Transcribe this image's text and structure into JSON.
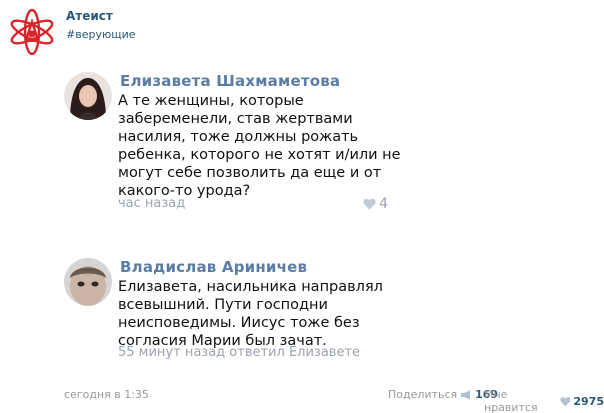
{
  "group": {
    "name": "Атеист",
    "hashtag": "#верующие"
  },
  "comments": [
    {
      "author": "Елизавета Шахмаметова",
      "lines": [
        "А те женщины, которые",
        "забеременели, став жертвами",
        "насилия, тоже должны рожать",
        "ребенка, которого не хотят и/или не",
        "могут себе позволить да еще и от",
        "какого-то урода?"
      ],
      "meta": "час назад",
      "likes": "4"
    },
    {
      "author": "Владислав Ариничев",
      "lines": [
        "Елизавета, насильника направлял",
        "всевышний. Пути господни",
        "неисповедимы. Иисус тоже без",
        "согласия Марии был зачат."
      ],
      "meta": "55 минут назад ответил Елизавете"
    }
  ],
  "footer": {
    "date": "сегодня в 1:35",
    "share_label": "Поделиться",
    "share_count": "169",
    "like_label": "Мне нравится",
    "like_count": "2975"
  },
  "colors": {
    "link": "#2b587a",
    "author": "#5b7da3",
    "muted": "#9ba3ad",
    "logo": "#d8262b"
  }
}
